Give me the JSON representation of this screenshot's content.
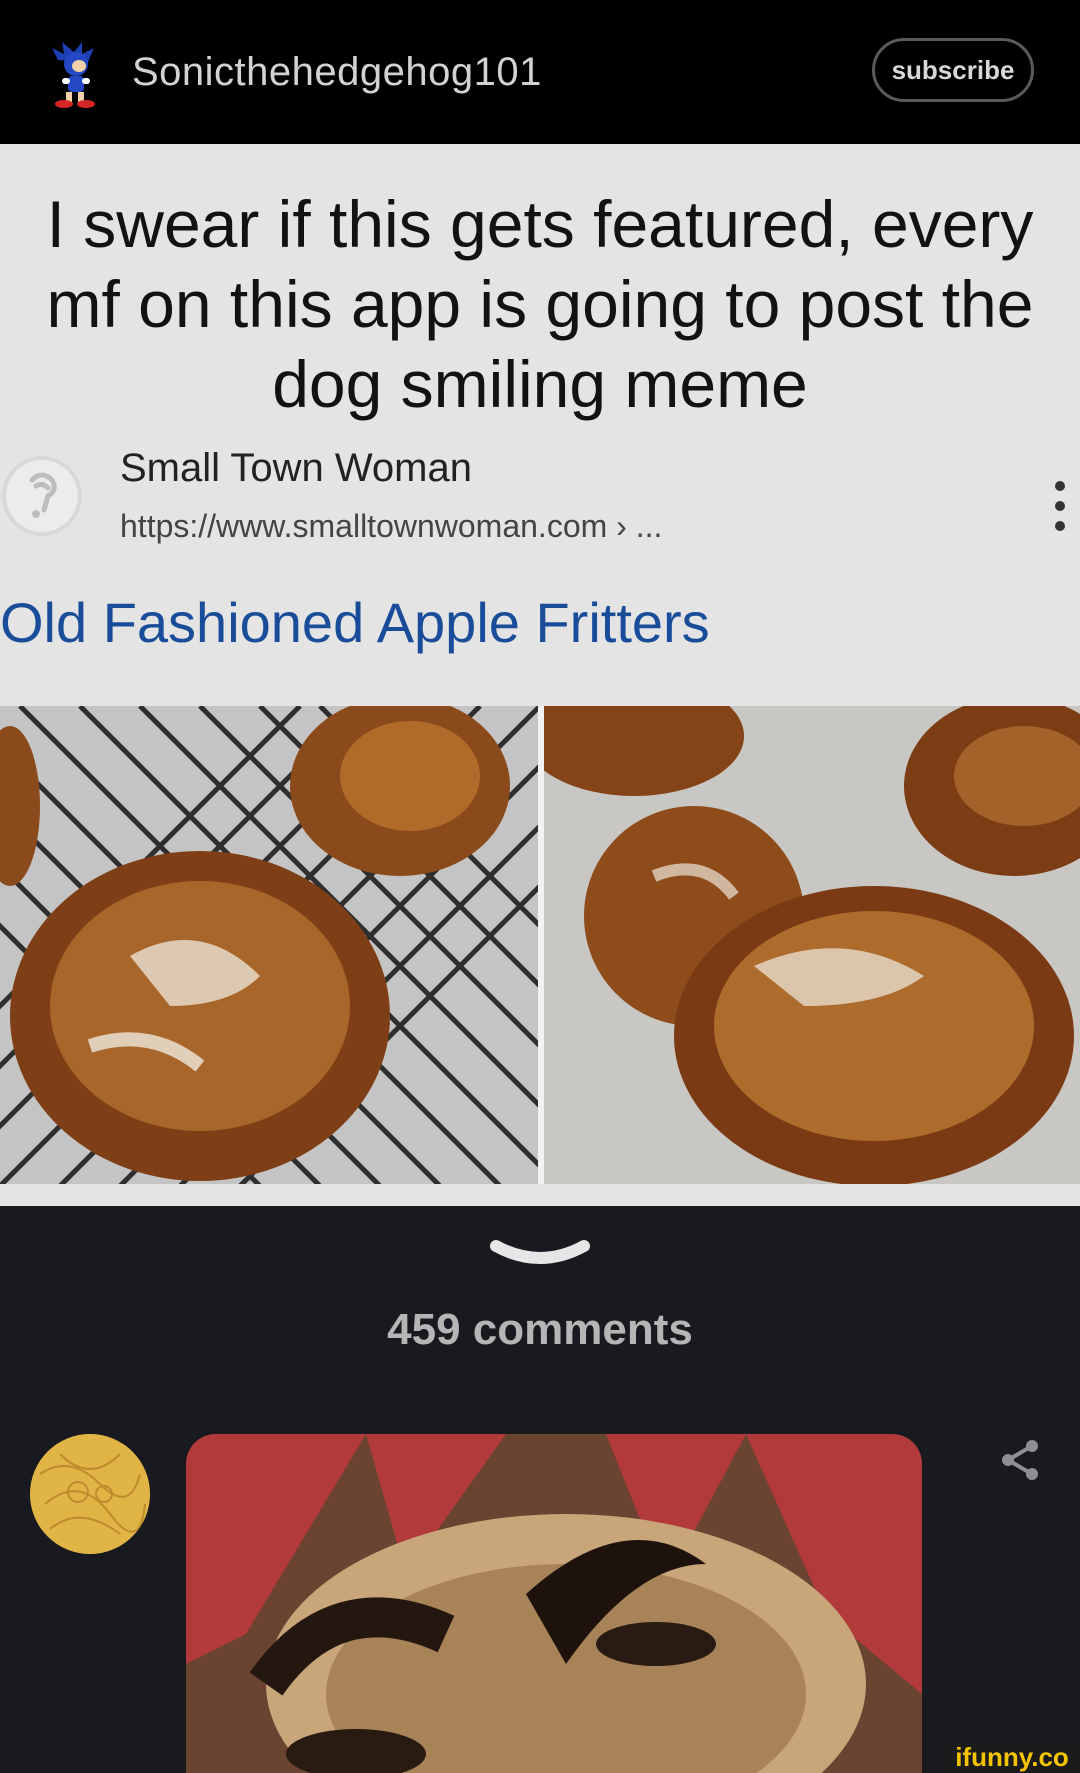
{
  "header": {
    "username": "Sonicthehedgehog101",
    "subscribe_label": "subscribe",
    "avatar_icon": "sonic-avatar-icon"
  },
  "post": {
    "caption": "I swear if this gets featured, every mf on this app is going to post the dog smiling meme",
    "search_result": {
      "site_name": "Small Town Woman",
      "url": "https://www.smalltownwoman.com › ...",
      "title": "Old Fashioned Apple Fritters",
      "title_color": "#1a4d99"
    },
    "images": [
      "apple-fritters-on-rack-photo",
      "apple-fritters-on-paper-photo"
    ]
  },
  "comments": {
    "count_label": "459 comments"
  },
  "comment_preview": {
    "avatar_color": "#e0b445",
    "share_icon": "share-icon"
  },
  "watermark": "ifunny.co"
}
